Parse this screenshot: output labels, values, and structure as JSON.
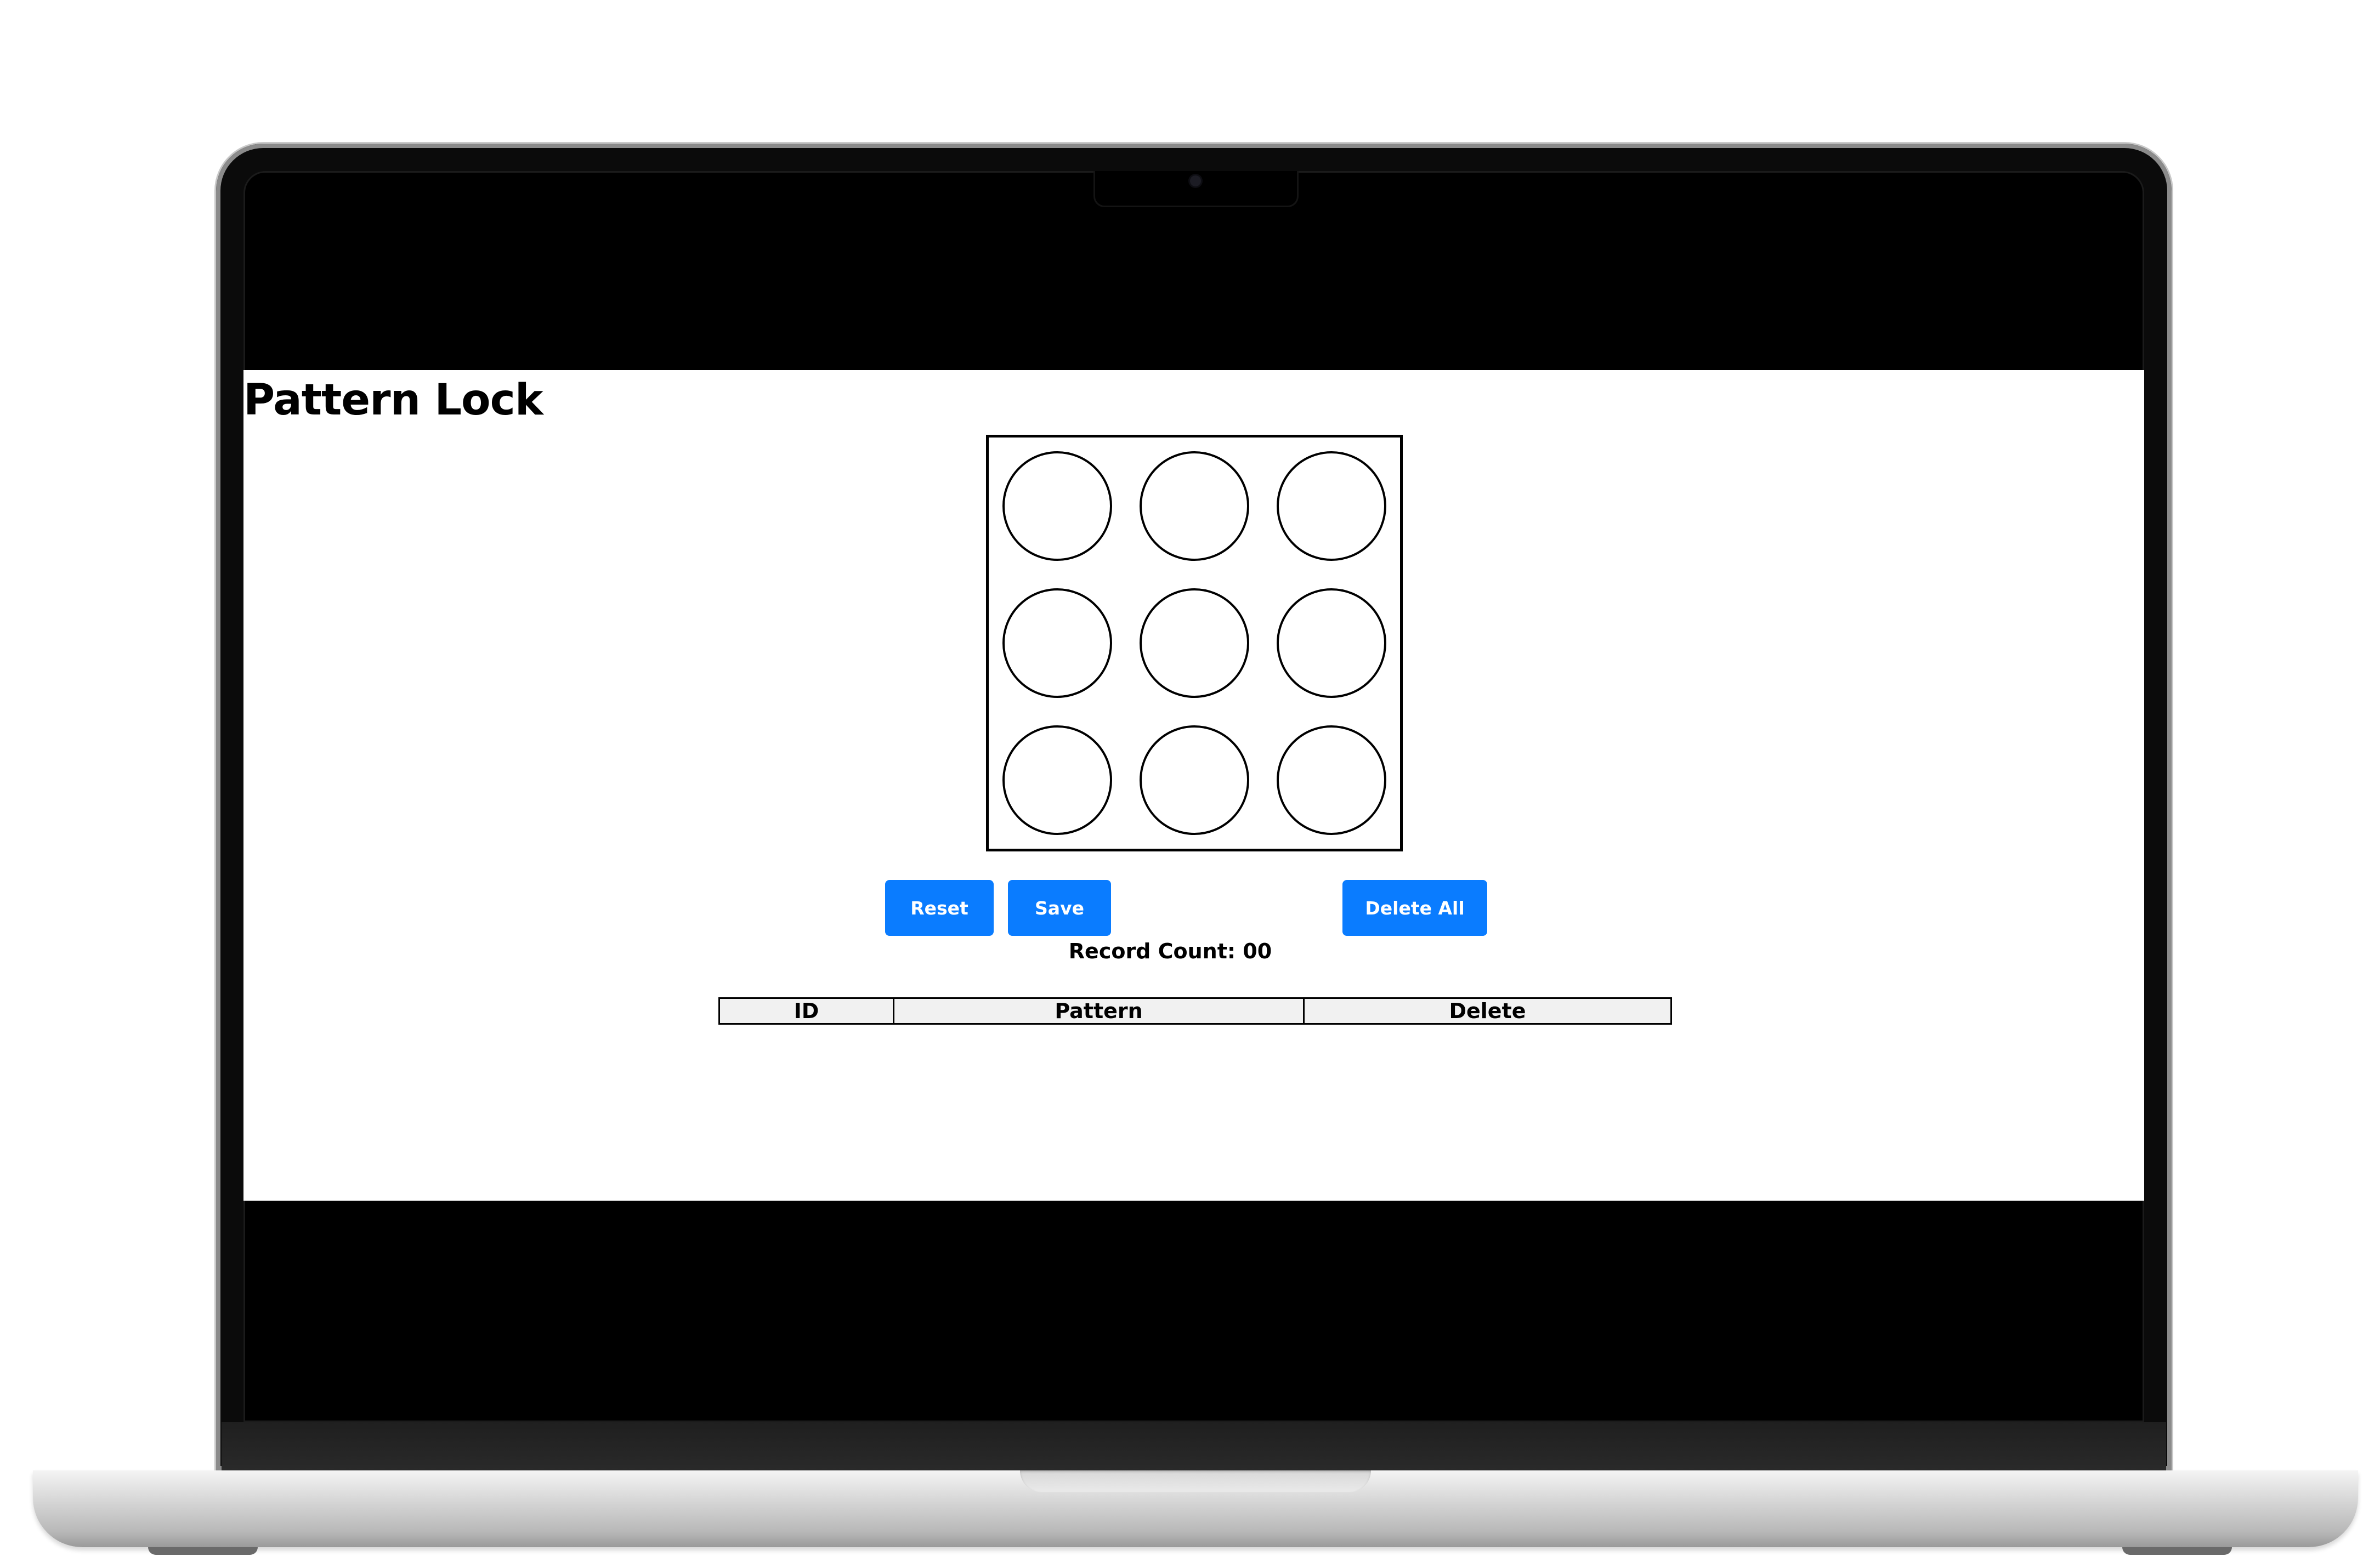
{
  "app": {
    "title": "Pattern Lock"
  },
  "pattern_grid": {
    "rows": 3,
    "cols": 3,
    "dots": [
      {
        "id": 1,
        "selected": false
      },
      {
        "id": 2,
        "selected": false
      },
      {
        "id": 3,
        "selected": false
      },
      {
        "id": 4,
        "selected": false
      },
      {
        "id": 5,
        "selected": false
      },
      {
        "id": 6,
        "selected": false
      },
      {
        "id": 7,
        "selected": false
      },
      {
        "id": 8,
        "selected": false
      },
      {
        "id": 9,
        "selected": false
      }
    ]
  },
  "controls": {
    "reset_label": "Reset",
    "save_label": "Save",
    "delete_all_label": "Delete All",
    "accent_color": "#0a7cff"
  },
  "records": {
    "count_text": "Record Count: 00",
    "columns": [
      "ID",
      "Pattern",
      "Delete"
    ],
    "rows": []
  }
}
